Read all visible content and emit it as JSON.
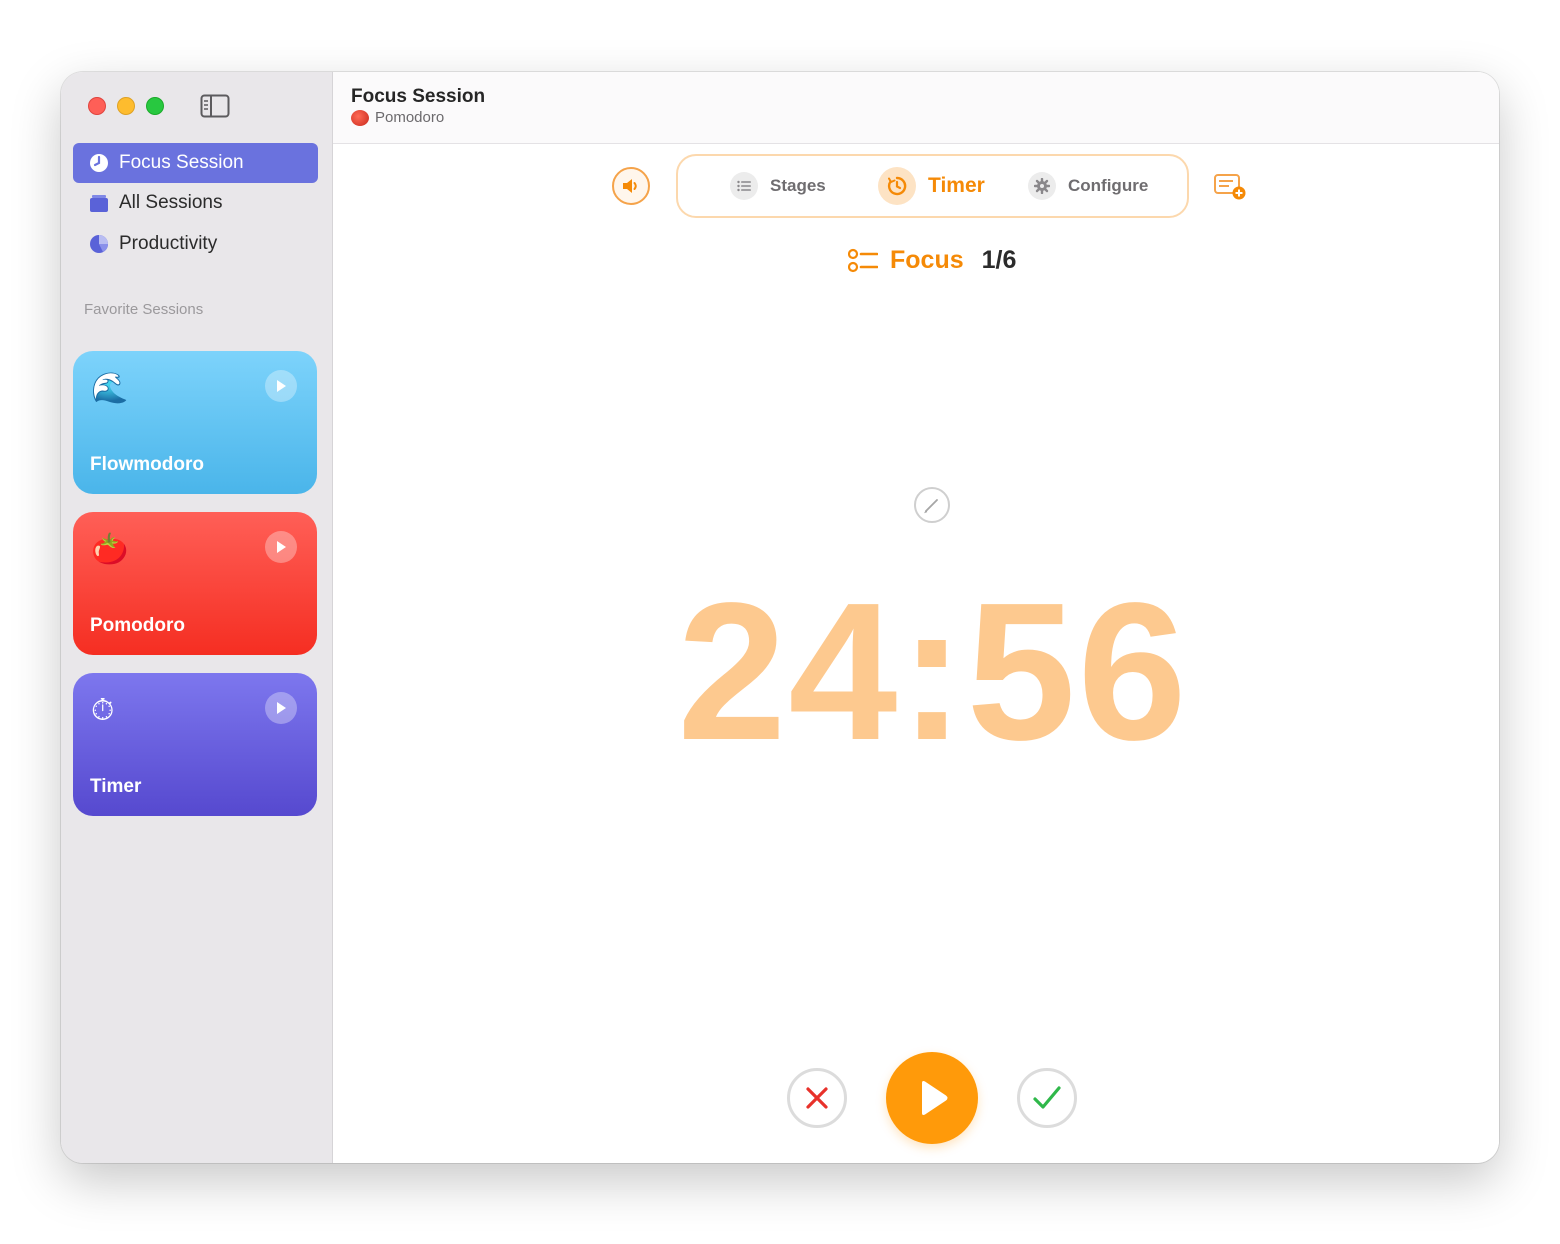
{
  "window": {
    "title": "Focus Session",
    "subtitle": "Pomodoro"
  },
  "sidebar": {
    "items": [
      {
        "label": "Focus Session",
        "icon": "timer-icon",
        "active": true
      },
      {
        "label": "All Sessions",
        "icon": "stack-icon",
        "active": false
      },
      {
        "label": "Productivity",
        "icon": "pie-chart-icon",
        "active": false
      }
    ],
    "section_label": "Favorite Sessions",
    "favorites": [
      {
        "title": "Flowmodoro",
        "emoji": "🌊",
        "color": "#4ab5ea"
      },
      {
        "title": "Pomodoro",
        "emoji": "🍅",
        "color": "#f52e22"
      },
      {
        "title": "Timer",
        "emoji": "⏱",
        "color": "#5649cf"
      }
    ]
  },
  "toolbar": {
    "tabs": [
      {
        "label": "Stages",
        "icon": "list-icon",
        "selected": false
      },
      {
        "label": "Timer",
        "icon": "timer-icon",
        "selected": true
      },
      {
        "label": "Configure",
        "icon": "gear-icon",
        "selected": false
      }
    ]
  },
  "stage": {
    "name": "Focus",
    "count": "1/6"
  },
  "timer": {
    "display": "24:56"
  },
  "colors": {
    "accent": "#f58a07",
    "sidebar_active": "#6a72de",
    "timer_text": "#fdc98f",
    "cancel": "#e8312a",
    "done": "#2fb84a"
  }
}
